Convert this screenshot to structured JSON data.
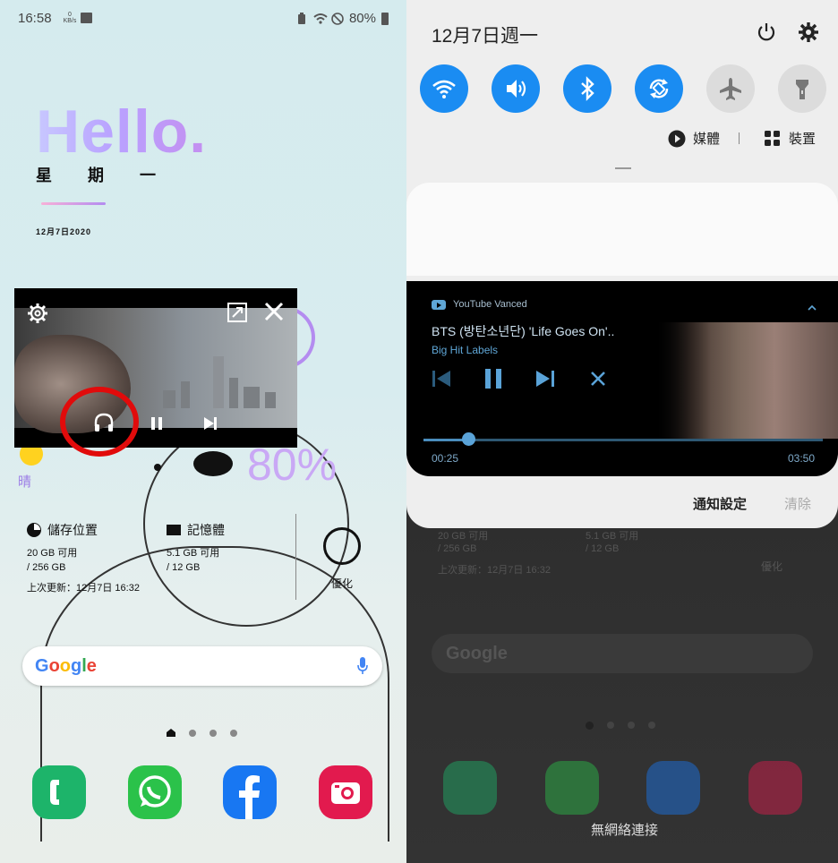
{
  "left": {
    "status": {
      "time": "16:58",
      "net_speed": "0\nKB/s",
      "battery": "80%"
    },
    "hello": "Hello.",
    "weekday": "星期一",
    "date": "12月7日2020",
    "weather": {
      "label": "晴"
    },
    "battery_widget": "80%",
    "device_care": {
      "storage_label": "儲存位置",
      "storage_value": "20 GB 可用",
      "storage_total": "/ 256 GB",
      "memory_label": "記憶體",
      "memory_value": "5.1 GB 可用",
      "memory_total": "/ 12 GB",
      "updated": "上次更新：12月7日 16:32",
      "optimize_label": "優化"
    },
    "google_label": "Google",
    "apps": [
      "phone",
      "whatsapp",
      "facebook",
      "camera"
    ]
  },
  "right": {
    "date": "12月7日週一",
    "media_output": "媒體",
    "devices": "裝置",
    "media": {
      "app": "YouTube Vanced",
      "title": "BTS (방탄소년단) 'Life Goes On'..",
      "artist": "Big Hit Labels",
      "current": "00:25",
      "duration": "03:50",
      "progress": 0.111
    },
    "notif_settings": "通知設定",
    "clear": "清除",
    "dim": {
      "storage_value": "20 GB 可用",
      "storage_total": "/ 256 GB",
      "updated": "上次更新：12月7日 16:32",
      "memory_value": "5.1 GB 可用",
      "memory_total": "/ 12 GB",
      "optimize_label": "優化",
      "google_label": "Google"
    },
    "no_network": "無網絡連接"
  },
  "colors": {
    "accent_blue": "#1a8cf2",
    "highlight_red": "#e10b0b"
  }
}
